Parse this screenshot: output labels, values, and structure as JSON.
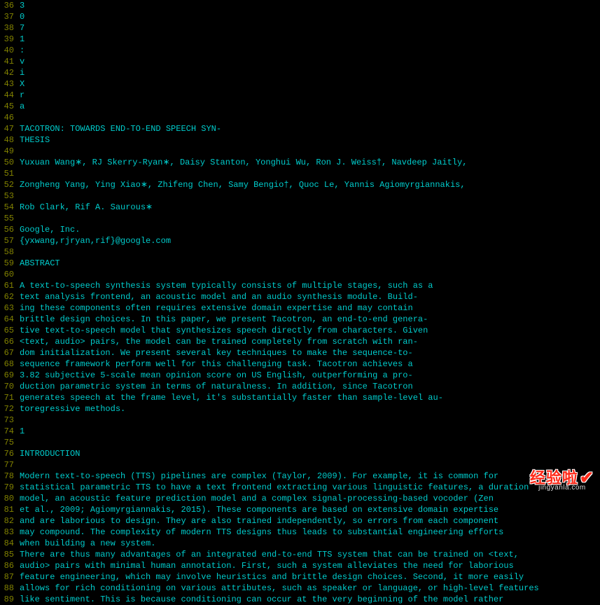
{
  "watermark": {
    "main": "经验啦",
    "sub": "jingyanla.com"
  },
  "lines": [
    {
      "num": 36,
      "text": "3"
    },
    {
      "num": 37,
      "text": "0"
    },
    {
      "num": 38,
      "text": "7"
    },
    {
      "num": 39,
      "text": "1"
    },
    {
      "num": 40,
      "text": ":"
    },
    {
      "num": 41,
      "text": "v"
    },
    {
      "num": 42,
      "text": "i"
    },
    {
      "num": 43,
      "text": "X"
    },
    {
      "num": 44,
      "text": "r"
    },
    {
      "num": 45,
      "text": "a"
    },
    {
      "num": 46,
      "text": ""
    },
    {
      "num": 47,
      "text": "TACOTRON: TOWARDS END-TO-END SPEECH SYN-"
    },
    {
      "num": 48,
      "text": "THESIS"
    },
    {
      "num": 49,
      "text": ""
    },
    {
      "num": 50,
      "text": "Yuxuan Wang∗, RJ Skerry-Ryan∗, Daisy Stanton, Yonghui Wu, Ron J. Weiss†, Navdeep Jaitly,"
    },
    {
      "num": 51,
      "text": ""
    },
    {
      "num": 52,
      "text": "Zongheng Yang, Ying Xiao∗, Zhifeng Chen, Samy Bengio†, Quoc Le, Yannis Agiomyrgiannakis,"
    },
    {
      "num": 53,
      "text": ""
    },
    {
      "num": 54,
      "text": "Rob Clark, Rif A. Saurous∗"
    },
    {
      "num": 55,
      "text": ""
    },
    {
      "num": 56,
      "text": "Google, Inc."
    },
    {
      "num": 57,
      "text": "{yxwang,rjryan,rif}@google.com"
    },
    {
      "num": 58,
      "text": ""
    },
    {
      "num": 59,
      "text": "ABSTRACT"
    },
    {
      "num": 60,
      "text": ""
    },
    {
      "num": 61,
      "text": "A text-to-speech synthesis system typically consists of multiple stages, such as a"
    },
    {
      "num": 62,
      "text": "text analysis frontend, an acoustic model and an audio synthesis module. Build-"
    },
    {
      "num": 63,
      "text": "ing these components often requires extensive domain expertise and may contain"
    },
    {
      "num": 64,
      "text": "brittle design choices. In this paper, we present Tacotron, an end-to-end genera-"
    },
    {
      "num": 65,
      "text": "tive text-to-speech model that synthesizes speech directly from characters. Given"
    },
    {
      "num": 66,
      "text": "<text, audio> pairs, the model can be trained completely from scratch with ran-"
    },
    {
      "num": 67,
      "text": "dom initialization. We present several key techniques to make the sequence-to-"
    },
    {
      "num": 68,
      "text": "sequence framework perform well for this challenging task. Tacotron achieves a"
    },
    {
      "num": 69,
      "text": "3.82 subjective 5-scale mean opinion score on US English, outperforming a pro-"
    },
    {
      "num": 70,
      "text": "duction parametric system in terms of naturalness. In addition, since Tacotron"
    },
    {
      "num": 71,
      "text": "generates speech at the frame level, it's substantially faster than sample-level au-"
    },
    {
      "num": 72,
      "text": "toregressive methods."
    },
    {
      "num": 73,
      "text": ""
    },
    {
      "num": 74,
      "text": "1"
    },
    {
      "num": 75,
      "text": ""
    },
    {
      "num": 76,
      "text": "INTRODUCTION"
    },
    {
      "num": 77,
      "text": ""
    },
    {
      "num": 78,
      "text": "Modern text-to-speech (TTS) pipelines are complex (Taylor, 2009). For example, it is common for"
    },
    {
      "num": 79,
      "text": "statistical parametric TTS to have a text frontend extracting various linguistic features, a duration"
    },
    {
      "num": 80,
      "text": "model, an acoustic feature prediction model and a complex signal-processing-based vocoder (Zen"
    },
    {
      "num": 81,
      "text": "et al., 2009; Agiomyrgiannakis, 2015). These components are based on extensive domain expertise"
    },
    {
      "num": 82,
      "text": "and are laborious to design. They are also trained independently, so errors from each component"
    },
    {
      "num": 83,
      "text": "may compound. The complexity of modern TTS designs thus leads to substantial engineering efforts"
    },
    {
      "num": 84,
      "text": "when building a new system."
    },
    {
      "num": 85,
      "text": "There are thus many advantages of an integrated end-to-end TTS system that can be trained on <text,"
    },
    {
      "num": 86,
      "text": "audio> pairs with minimal human annotation. First, such a system alleviates the need for laborious"
    },
    {
      "num": 87,
      "text": "feature engineering, which may involve heuristics and brittle design choices. Second, it more easily"
    },
    {
      "num": 88,
      "text": "allows for rich conditioning on various attributes, such as speaker or language, or high-level features"
    },
    {
      "num": 89,
      "text": "like sentiment. This is because conditioning can occur at the very beginning of the model rather"
    }
  ]
}
